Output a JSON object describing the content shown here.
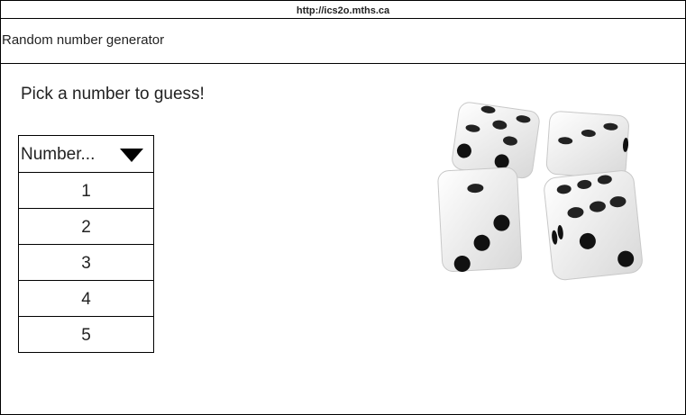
{
  "browser": {
    "url": "http://ics2o.mths.ca"
  },
  "header": {
    "title": "Random number generator"
  },
  "main": {
    "prompt": "Pick a number to guess!",
    "dropdown": {
      "selected": "Number...",
      "options": [
        "1",
        "2",
        "3",
        "4",
        "5"
      ]
    },
    "image": {
      "icon": "dice-image"
    }
  }
}
